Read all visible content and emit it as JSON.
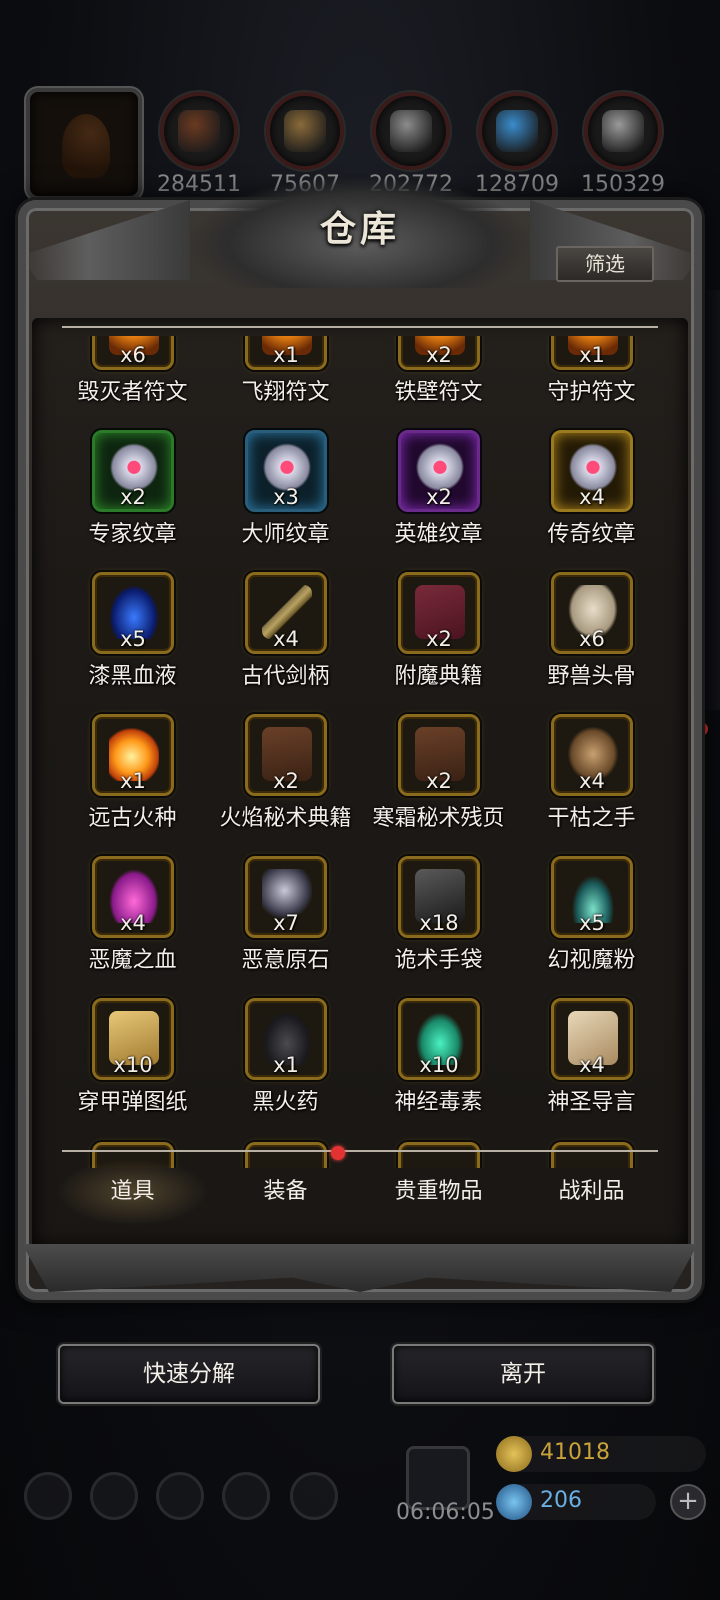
{
  "resources": [
    {
      "value": "284511",
      "icon": "meat-icon",
      "color": "#6b3a22"
    },
    {
      "value": "75607",
      "icon": "wood-icon",
      "color": "#8a6a3a"
    },
    {
      "value": "202772",
      "icon": "stone-icon",
      "color": "#8c8c8c"
    },
    {
      "value": "128709",
      "icon": "crystal-icon",
      "color": "#3a8ccc"
    },
    {
      "value": "150329",
      "icon": "iron-icon",
      "color": "#9a9a9a"
    }
  ],
  "panel": {
    "title": "仓库",
    "filter_label": "筛选"
  },
  "items": [
    {
      "name": "毁灭者符文",
      "qty": "x6",
      "frame": "gold-frame",
      "icon": "fire-rune-icon"
    },
    {
      "name": "飞翔符文",
      "qty": "x1",
      "frame": "gold-frame",
      "icon": "fire-rune-icon"
    },
    {
      "name": "铁壁符文",
      "qty": "x2",
      "frame": "gold-frame",
      "icon": "fire-rune-icon"
    },
    {
      "name": "守护符文",
      "qty": "x1",
      "frame": "gold-frame",
      "icon": "fire-rune-icon"
    },
    {
      "name": "专家纹章",
      "qty": "x2",
      "frame": "green",
      "icon": "crest-icon"
    },
    {
      "name": "大师纹章",
      "qty": "x3",
      "frame": "blue",
      "icon": "crest-icon"
    },
    {
      "name": "英雄纹章",
      "qty": "x2",
      "frame": "purple",
      "icon": "crest-icon"
    },
    {
      "name": "传奇纹章",
      "qty": "x4",
      "frame": "gold",
      "icon": "crest-icon"
    },
    {
      "name": "漆黑血液",
      "qty": "x5",
      "frame": "gold-frame",
      "icon": "blue-drop-icon"
    },
    {
      "name": "古代剑柄",
      "qty": "x4",
      "frame": "gold-frame",
      "icon": "sword-hilt-icon"
    },
    {
      "name": "附魔典籍",
      "qty": "x2",
      "frame": "gold-frame",
      "icon": "spellbook-icon"
    },
    {
      "name": "野兽头骨",
      "qty": "x6",
      "frame": "gold-frame",
      "icon": "skull-icon"
    },
    {
      "name": "远古火种",
      "qty": "x1",
      "frame": "gold-frame",
      "icon": "fire-seed-icon"
    },
    {
      "name": "火焰秘术典籍",
      "qty": "x2",
      "frame": "gold-frame",
      "icon": "book-icon"
    },
    {
      "name": "寒霜秘术残页",
      "qty": "x2",
      "frame": "gold-frame",
      "icon": "book-icon"
    },
    {
      "name": "干枯之手",
      "qty": "x4",
      "frame": "gold-frame",
      "icon": "withered-hand-icon"
    },
    {
      "name": "恶魔之血",
      "qty": "x4",
      "frame": "gold-frame",
      "icon": "pink-drop-icon"
    },
    {
      "name": "恶意原石",
      "qty": "x7",
      "frame": "gold-frame",
      "icon": "ore-icon"
    },
    {
      "name": "诡术手袋",
      "qty": "x18",
      "frame": "gold-frame",
      "icon": "bag-icon"
    },
    {
      "name": "幻视魔粉",
      "qty": "x5",
      "frame": "gold-frame",
      "icon": "powder-icon"
    },
    {
      "name": "穿甲弹图纸",
      "qty": "x10",
      "frame": "gold-frame",
      "icon": "scroll-icon"
    },
    {
      "name": "黑火药",
      "qty": "x1",
      "frame": "gold-frame",
      "icon": "gunpowder-icon"
    },
    {
      "name": "神经毒素",
      "qty": "x10",
      "frame": "gold-frame",
      "icon": "potion-icon"
    },
    {
      "name": "神圣导言",
      "qty": "x4",
      "frame": "gold-frame",
      "icon": "parchment-icon"
    }
  ],
  "tabs": [
    {
      "label": "道具",
      "active": true
    },
    {
      "label": "装备",
      "badge": true
    },
    {
      "label": "贵重物品"
    },
    {
      "label": "战利品"
    }
  ],
  "actions": {
    "decompose": "快速分解",
    "leave": "离开"
  },
  "hud": {
    "timer": "06:06:05",
    "gold": "41018",
    "gems": "206",
    "gold_color": "#c9a33a",
    "gem_color": "#3a8ccc"
  }
}
